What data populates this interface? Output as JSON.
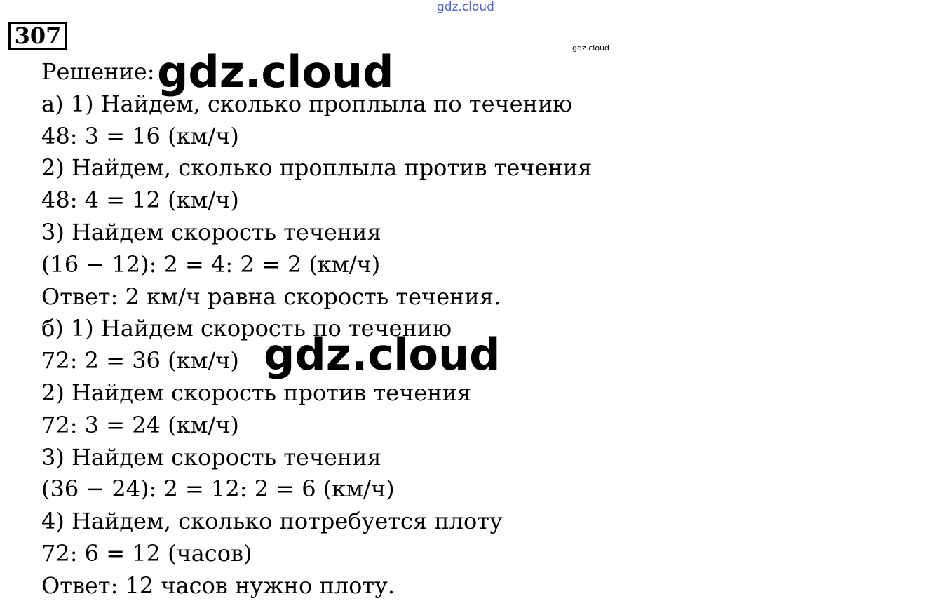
{
  "watermarks": {
    "top": "gdz.cloud",
    "small": "gdz.cloud",
    "big_1": "gdz.cloud",
    "big_2": "gdz.cloud"
  },
  "task_number": "307",
  "lines": [
    "Решение:",
    "а) 1) Найдем, сколько проплыла по течению",
    "48: 3 = 16 (км/ч)",
    "2) Найдем, сколько проплыла против течения",
    "48: 4 = 12 (км/ч)",
    "3) Найдем скорость течения",
    "(16 − 12): 2 = 4: 2 = 2 (км/ч)",
    "Ответ: 2 км/ч равна скорость течения.",
    "б) 1) Найдем скорость по течению",
    "72: 2 = 36 (км/ч)",
    "2) Найдем скорость против течения",
    "72: 3 = 24 (км/ч)",
    "3) Найдем скорость течения",
    "(36 − 24): 2 = 12: 2 = 6 (км/ч)",
    "4) Найдем, сколько потребуется плоту",
    "72: 6 = 12 (часов)",
    "Ответ: 12 часов нужно плоту."
  ]
}
